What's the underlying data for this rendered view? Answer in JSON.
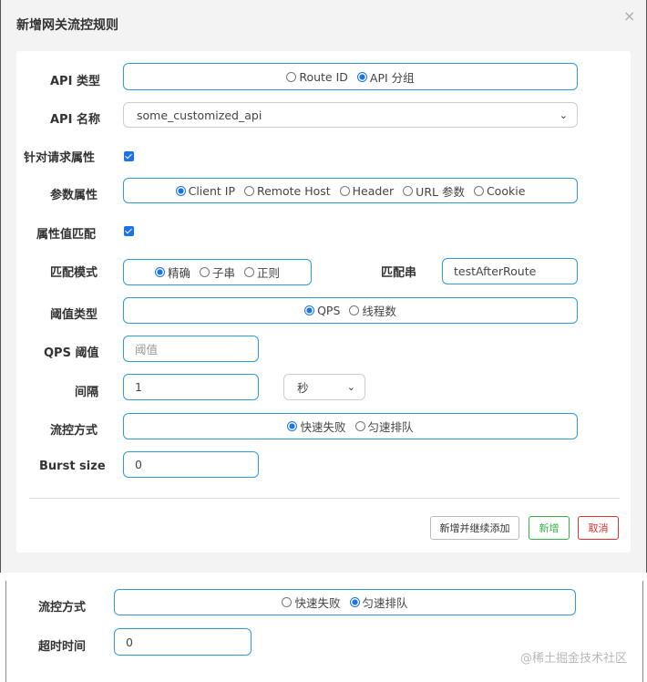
{
  "dialog": {
    "title": "新增网关流控规则",
    "close_label": "×"
  },
  "form": {
    "api_type": {
      "label": "API 类型",
      "options": [
        {
          "label": "Route ID",
          "selected": false
        },
        {
          "label": "API 分组",
          "selected": true
        }
      ]
    },
    "api_name": {
      "label": "API 名称",
      "value": "some_customized_api"
    },
    "request_attr": {
      "label": "针对请求属性",
      "checked": true
    },
    "param_attr": {
      "label": "参数属性",
      "options": [
        {
          "label": "Client IP",
          "selected": true
        },
        {
          "label": "Remote Host",
          "selected": false
        },
        {
          "label": "Header",
          "selected": false
        },
        {
          "label": "URL 参数",
          "selected": false
        },
        {
          "label": "Cookie",
          "selected": false
        }
      ]
    },
    "value_match": {
      "label": "属性值匹配",
      "checked": true
    },
    "match_mode": {
      "label": "匹配模式",
      "options": [
        {
          "label": "精确",
          "selected": true
        },
        {
          "label": "子串",
          "selected": false
        },
        {
          "label": "正则",
          "selected": false
        }
      ]
    },
    "match_string": {
      "label": "匹配串",
      "value": "testAfterRoute"
    },
    "threshold_type": {
      "label": "阈值类型",
      "options": [
        {
          "label": "QPS",
          "selected": true
        },
        {
          "label": "线程数",
          "selected": false
        }
      ]
    },
    "qps_threshold": {
      "label": "QPS 阈值",
      "placeholder": "阈值"
    },
    "interval": {
      "label": "间隔",
      "value": "1",
      "unit": "秒"
    },
    "flow_mode": {
      "label": "流控方式",
      "options": [
        {
          "label": "快速失败",
          "selected": true
        },
        {
          "label": "匀速排队",
          "selected": false
        }
      ]
    },
    "burst_size": {
      "label": "Burst size",
      "value": "0"
    }
  },
  "buttons": {
    "save_continue": "新增并继续添加",
    "add": "新增",
    "cancel": "取消"
  },
  "bottom": {
    "flow_mode": {
      "label": "流控方式",
      "options": [
        {
          "label": "快速失败",
          "selected": false
        },
        {
          "label": "匀速排队",
          "selected": true
        }
      ]
    },
    "timeout": {
      "label": "超时时间",
      "value": "0"
    }
  },
  "watermark": "@稀土掘金技术社区",
  "colors": {
    "accent": "#2f9ae0",
    "radio": "#1a73e8",
    "ok": "#37b24d",
    "cancel": "#e03131"
  }
}
